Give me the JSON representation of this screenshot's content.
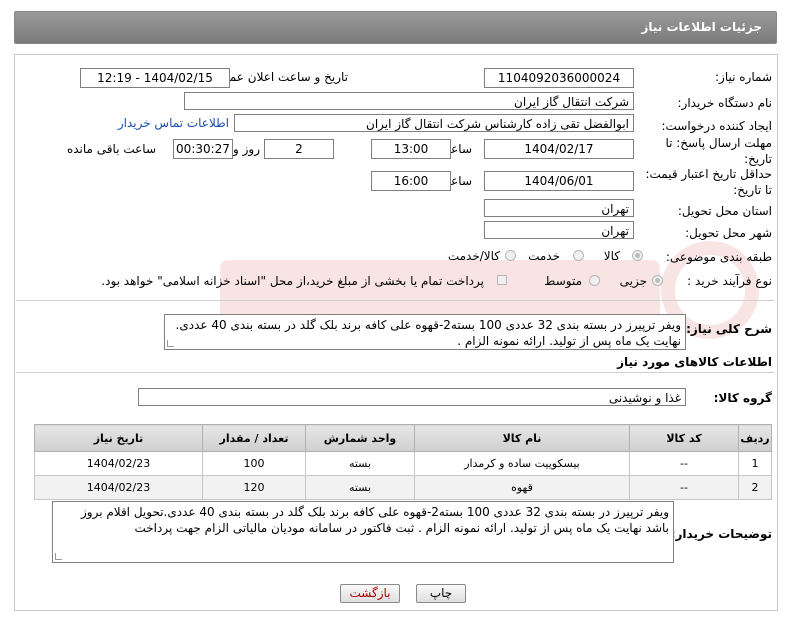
{
  "header": {
    "title": "جزئیات اطلاعات نیاز"
  },
  "fields": {
    "need_number_label": "شماره نیاز:",
    "need_number": "1104092036000024",
    "announce_label": "تاریخ و ساعت اعلان عمومی:",
    "announce_value": "1404/02/15 - 12:19",
    "buyer_org_label": "نام دستگاه خریدار:",
    "buyer_org": "شرکت انتقال گاز ایران",
    "creator_label": "ایجاد کننده درخواست:",
    "creator": "ابوالفضل تقی زاده کارشناس شرکت انتقال گاز ایران",
    "contact_link": "اطلاعات تماس خریدار",
    "deadline_label_1": "مهلت ارسال پاسخ: تا",
    "deadline_label_2": "تاریخ:",
    "deadline_date": "1404/02/17",
    "time_label": "ساعت",
    "deadline_time": "13:00",
    "days_value": "2",
    "days_label": "روز و",
    "remaining_time": "00:30:27",
    "remaining_label": "ساعت باقی مانده",
    "validity_label_1": "حداقل تاریخ اعتبار قیمت:",
    "validity_label_2": "تا تاریخ:",
    "validity_date": "1404/06/01",
    "validity_time_label": "ساعت",
    "validity_time": "16:00",
    "province_label": "استان محل تحویل:",
    "province": "تهران",
    "city_label": "شهر محل تحویل:",
    "city": "تهران",
    "category_label": "طبقه بندی موضوعی:",
    "category_options": [
      "کالا",
      "خدمت",
      "کالا/خدمت"
    ],
    "process_label": "نوع فرآیند خرید :",
    "process_options": [
      "جزیی",
      "متوسط"
    ],
    "payment_note": "پرداخت تمام یا بخشی از مبلغ خرید،از محل \"اسناد خزانه اسلامی\" خواهد بود.",
    "description_label": "شرح کلی نیاز:",
    "description": "ویفر ترپیرز در بسته بندی 32 عددی 100 بسته2-قهوه علی کافه برند بلک گلد در بسته بندی 40 عددی. نهایت یک ماه پس از تولید. ارائه نمونه الزام .",
    "goods_section_title": "اطلاعات کالاهای مورد نیاز",
    "goods_group_label": "گروه کالا:",
    "goods_group": "غذا و نوشیدنی",
    "buyer_notes_label": "توضیحات خریدار:",
    "buyer_notes": "ویفر ترپیرز در بسته بندی 32 عددی 100 بسته2-قهوه علی کافه برند بلک گلد در بسته بندی 40 عددی.تحویل اقلام بروز باشد نهایت یک ماه پس از تولید. ارائه نمونه الزام . ثبت فاکتور در سامانه مودیان مالیاتی الزام جهت پرداخت"
  },
  "table": {
    "headers": [
      "ردیف",
      "کد کالا",
      "نام کالا",
      "واحد شمارش",
      "تعداد / مقدار",
      "تاریخ نیاز"
    ],
    "rows": [
      [
        "1",
        "--",
        "بیسکوییت ساده و کرمدار",
        "بسته",
        "100",
        "1404/02/23"
      ],
      [
        "2",
        "--",
        "قهوه",
        "بسته",
        "120",
        "1404/02/23"
      ]
    ]
  },
  "buttons": {
    "print": "چاپ",
    "back": "بازگشت"
  },
  "colors": {
    "header_bg": "#8c8c8c",
    "link": "#1a4fb3",
    "back_button_text": "#b00000"
  }
}
